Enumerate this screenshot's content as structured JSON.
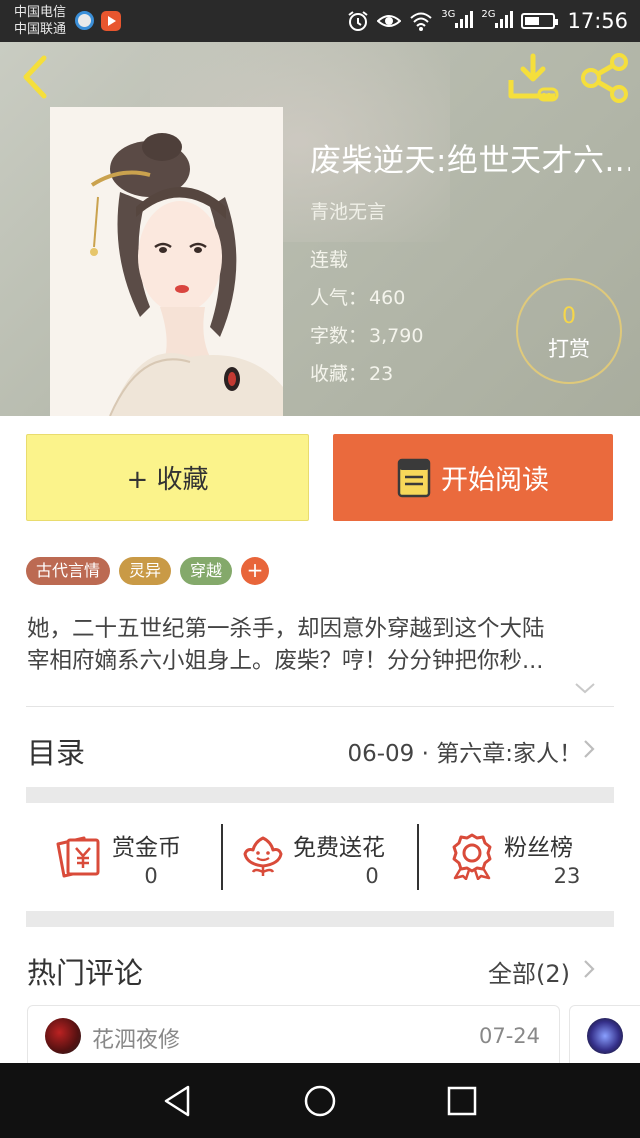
{
  "status_bar": {
    "carrier_1": "中国电信",
    "carrier_2": "中国联通",
    "net_1": "3G",
    "net_2": "2G",
    "time": "17:56"
  },
  "header": {
    "title": "废柴逆天:绝世天才六...",
    "author": "青池无言",
    "status": "连载",
    "popularity_label": "人气：",
    "popularity_value": "460",
    "words_label": "字数：",
    "words_value": "3,790",
    "favorites_label": "收藏：",
    "favorites_value": "23",
    "reward_count": "0",
    "reward_label": "打赏"
  },
  "actions": {
    "favorite_label": "+ 收藏",
    "read_label": "开始阅读"
  },
  "tags": [
    "古代言情",
    "灵异",
    "穿越"
  ],
  "tag_add": "+",
  "description": {
    "line_1": "她，二十五世纪第一杀手，却因意外穿越到这个大陆",
    "line_2": "宰相府嫡系六小姐身上。废柴？哼！分分钟把你秒..."
  },
  "catalog": {
    "label": "目录",
    "latest": "06-09 · 第六章:家人！"
  },
  "stats": {
    "coins_label": "赏金币",
    "coins_value": "0",
    "flowers_label": "免费送花",
    "flowers_value": "0",
    "fans_label": "粉丝榜",
    "fans_value": "23"
  },
  "comments": {
    "title": "热门评论",
    "all_label": "全部(2)",
    "items": [
      {
        "user": "花泗夜修",
        "date": "07-24"
      }
    ]
  },
  "colors": {
    "favorite_bg": "#fbf38b",
    "read_bg": "#ea6a3d",
    "accent_gold": "#f5d64a",
    "icon_red": "#d94b3a"
  },
  "icons": [
    "back-icon",
    "download-icon",
    "share-icon",
    "book-icon",
    "coin-envelope-icon",
    "flower-icon",
    "medal-icon",
    "chevron-right-icon",
    "chevron-down-icon"
  ]
}
